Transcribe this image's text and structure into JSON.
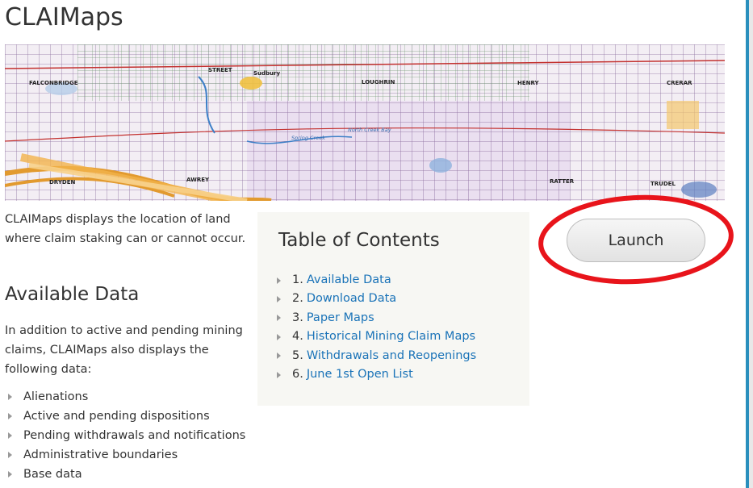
{
  "page": {
    "title": "CLAIMaps",
    "intro": "CLAIMaps displays the location of land where claim staking can or cannot occur."
  },
  "map_banner": {
    "labels": [
      "FALCONBRIDGE",
      "STREET",
      "Sudbury",
      "LOUGHRIN",
      "HENRY",
      "CRERAR",
      "DRYDEN",
      "AWREY",
      "RATTER",
      "TRUDEL",
      "Spring Creek",
      "North Creek Bay"
    ]
  },
  "available_data": {
    "heading": "Available Data",
    "intro": "In addition to active and pending mining claims, CLAIMaps also displays the following data:",
    "items": [
      "Alienations",
      "Active and pending dispositions",
      "Pending withdrawals and notifications",
      "Administrative boundaries",
      "Base data"
    ]
  },
  "toc": {
    "title": "Table of Contents",
    "items": [
      {
        "num": "1.",
        "label": "Available Data"
      },
      {
        "num": "2.",
        "label": "Download Data"
      },
      {
        "num": "3.",
        "label": "Paper Maps"
      },
      {
        "num": "4.",
        "label": "Historical Mining Claim Maps"
      },
      {
        "num": "5.",
        "label": "Withdrawals and Reopenings"
      },
      {
        "num": "6.",
        "label": "June 1st Open List"
      }
    ]
  },
  "launch_button": {
    "label": "Launch"
  },
  "colors": {
    "link": "#1a73b8",
    "annotation": "#e8141b",
    "border_accent": "#2a8fbd"
  }
}
